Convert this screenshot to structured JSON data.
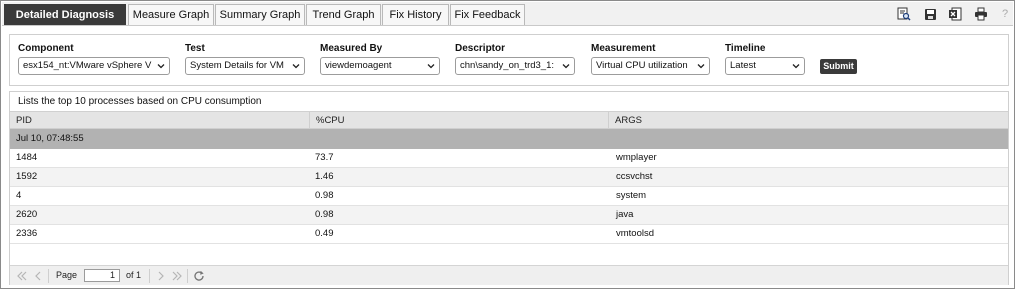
{
  "tabs": [
    {
      "label": "Detailed Diagnosis",
      "active": true
    },
    {
      "label": "Measure Graph"
    },
    {
      "label": "Summary Graph"
    },
    {
      "label": "Trend Graph"
    },
    {
      "label": "Fix History"
    },
    {
      "label": "Fix Feedback"
    }
  ],
  "toolbar_icons": [
    "search-document-icon",
    "save-icon",
    "excel-export-icon",
    "print-icon",
    "help-icon"
  ],
  "filters": {
    "component": {
      "label": "Component",
      "value": "esx154_nt:VMware vSphere V"
    },
    "test": {
      "label": "Test",
      "value": "System Details for VM"
    },
    "measured_by": {
      "label": "Measured By",
      "value": "viewdemoagent"
    },
    "descriptor": {
      "label": "Descriptor",
      "value": "chn\\sandy_on_trd3_1:"
    },
    "measurement": {
      "label": "Measurement",
      "value": "Virtual CPU utilization"
    },
    "timeline": {
      "label": "Timeline",
      "value": "Latest"
    },
    "submit_label": "Submit"
  },
  "results": {
    "caption": "Lists the top 10 processes based on CPU consumption",
    "columns": [
      "PID",
      "%CPU",
      "ARGS"
    ],
    "group": "Jul 10, 07:48:55",
    "rows": [
      {
        "pid": "1484",
        "cpu": "73.7",
        "args": "wmplayer"
      },
      {
        "pid": "1592",
        "cpu": "1.46",
        "args": "ccsvchst"
      },
      {
        "pid": "4",
        "cpu": "0.98",
        "args": "system"
      },
      {
        "pid": "2620",
        "cpu": "0.98",
        "args": "java"
      },
      {
        "pid": "2336",
        "cpu": "0.49",
        "args": "vmtoolsd"
      }
    ]
  },
  "pager": {
    "page_label": "Page",
    "current_page": "1",
    "of_label": "of 1"
  },
  "colors": {
    "active_tab": "#3a3a3a",
    "group_row": "#b2b2b2",
    "header_row": "#e4e4e4"
  }
}
